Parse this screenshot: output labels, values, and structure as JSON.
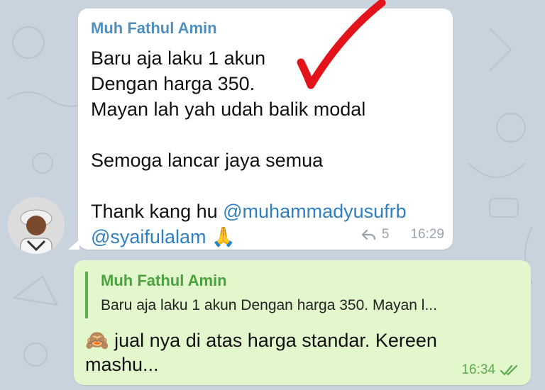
{
  "incoming": {
    "sender": "Muh Fathul Amin",
    "lines": [
      "Baru aja laku 1 akun",
      "Dengan harga 350.",
      "Mayan lah yah udah balik modal",
      "",
      "Semoga lancar jaya semua",
      "",
      "Thank kang hu "
    ],
    "mention1": "@muhammadyusufrb",
    "mention2": "@syaifulalam",
    "emoji": "🙏",
    "reply_count": "5",
    "time": "16:29",
    "reply_icon": "reply-arrow-icon"
  },
  "outgoing": {
    "quote_sender": "Muh Fathul Amin",
    "quote_text": "Baru aja laku 1 akun  Dengan harga 350.  Mayan l...",
    "emoji": "🙈",
    "text": " jual nya di atas harga standar. Kereen mashu...",
    "time": "16:34",
    "status_icon": "double-check-icon"
  },
  "colors": {
    "background": "#c9d3dd",
    "incoming_bubble": "#ffffff",
    "outgoing_bubble": "#e3f7cd",
    "sender_name": "#4f8fbf",
    "quote_accent": "#5ab14b",
    "annotation_red": "#e2131a"
  }
}
